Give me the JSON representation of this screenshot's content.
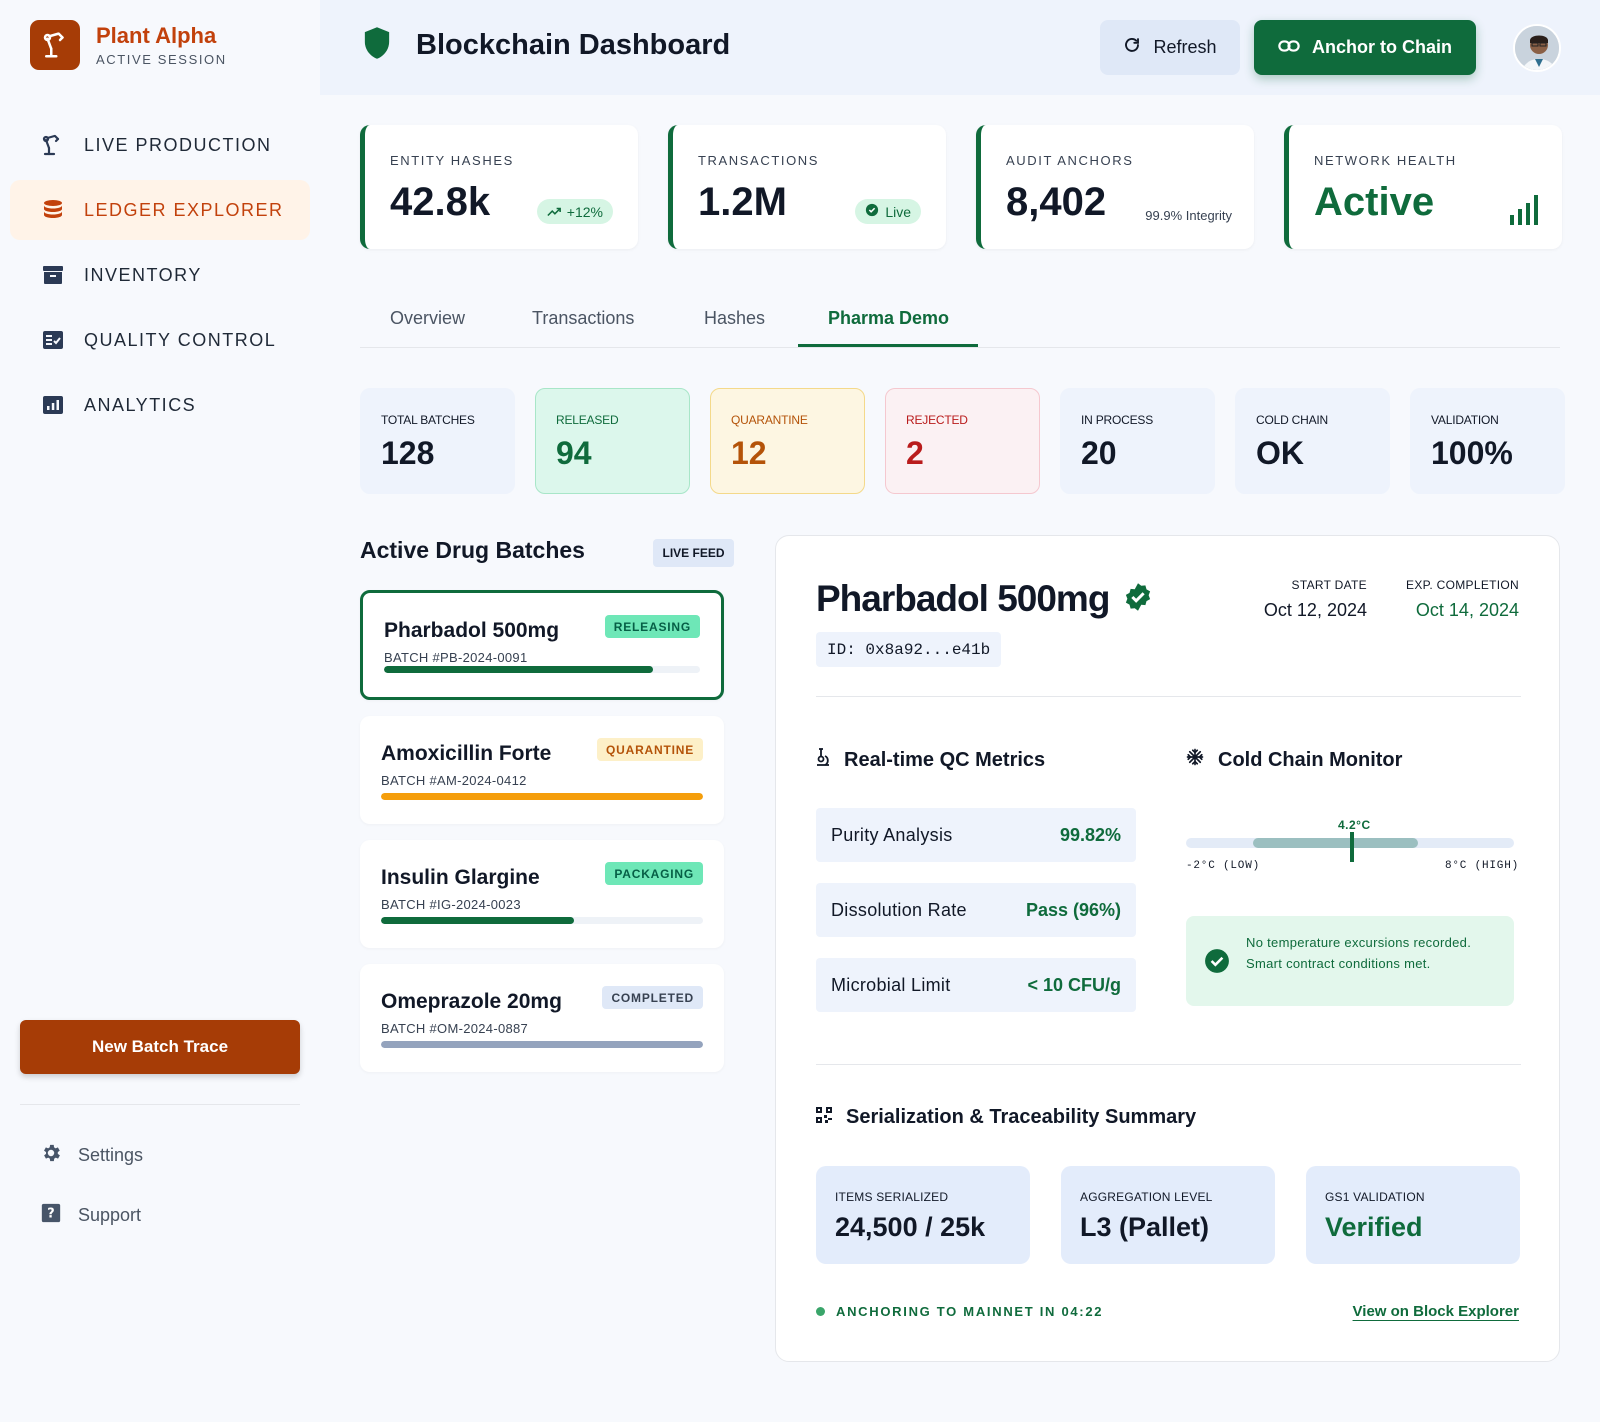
{
  "brand": {
    "name": "Plant Alpha",
    "subtitle": "ACTIVE SESSION",
    "color": "#c2410c",
    "logo_icon": "robot-arm-icon"
  },
  "sidebar": {
    "items": [
      {
        "label": "LIVE PRODUCTION",
        "icon": "robot-arm-icon",
        "active": false
      },
      {
        "label": "LEDGER EXPLORER",
        "icon": "database-icon",
        "active": true
      },
      {
        "label": "INVENTORY",
        "icon": "archive-icon",
        "active": false
      },
      {
        "label": "QUALITY CONTROL",
        "icon": "checklist-icon",
        "active": false
      },
      {
        "label": "ANALYTICS",
        "icon": "bar-chart-icon",
        "active": false
      }
    ],
    "new_batch_label": "New Batch Trace",
    "settings_label": "Settings",
    "support_label": "Support"
  },
  "header": {
    "title": "Blockchain Dashboard",
    "title_icon": "shield-icon",
    "refresh_label": "Refresh",
    "anchor_label": "Anchor to Chain"
  },
  "stats": [
    {
      "label": "ENTITY HASHES",
      "value": "42.8k",
      "badge": "+12%",
      "badge_icon": "trend-up-icon"
    },
    {
      "label": "TRANSACTIONS",
      "value": "1.2M",
      "badge": "Live",
      "badge_icon": "check-badge-icon"
    },
    {
      "label": "AUDIT ANCHORS",
      "value": "8,402",
      "note": "99.9% Integrity"
    },
    {
      "label": "NETWORK HEALTH",
      "value": "Active",
      "icon": "signal-bars-icon"
    }
  ],
  "tabs": [
    {
      "label": "Overview",
      "active": false
    },
    {
      "label": "Transactions",
      "active": false
    },
    {
      "label": "Hashes",
      "active": false
    },
    {
      "label": "Pharma Demo",
      "active": true
    }
  ],
  "summary": [
    {
      "label": "TOTAL BATCHES",
      "value": "128",
      "bg": "#eef3fc",
      "border": "#eef3fc",
      "color": "#111827"
    },
    {
      "label": "RELEASED",
      "value": "94",
      "bg": "#dcf7ec",
      "border": "#a8e6c8",
      "color": "#0f6b3c"
    },
    {
      "label": "QUARANTINE",
      "value": "12",
      "bg": "#fdf6e2",
      "border": "#f4d98a",
      "color": "#b45309"
    },
    {
      "label": "REJECTED",
      "value": "2",
      "bg": "#fbf1f3",
      "border": "#f5c8cf",
      "color": "#b91c1c"
    },
    {
      "label": "IN PROCESS",
      "value": "20",
      "bg": "#eef3fc",
      "border": "#eef3fc",
      "color": "#111827"
    },
    {
      "label": "COLD CHAIN",
      "value": "OK",
      "bg": "#eef3fc",
      "border": "#eef3fc",
      "color": "#111827"
    },
    {
      "label": "VALIDATION",
      "value": "100%",
      "bg": "#eef3fc",
      "border": "#eef3fc",
      "color": "#111827"
    }
  ],
  "batches": {
    "title": "Active Drug Batches",
    "feed_label": "LIVE FEED",
    "items": [
      {
        "name": "Pharbadol 500mg",
        "id": "BATCH #PB-2024-0091",
        "status": "RELEASING",
        "badge_bg": "#6ee7b7",
        "badge_color": "#065f46",
        "progress": 0.85,
        "bar_color": "#0f6b3c",
        "active": true
      },
      {
        "name": "Amoxicillin Forte",
        "id": "BATCH #AM-2024-0412",
        "status": "QUARANTINE",
        "badge_bg": "#fdf0c8",
        "badge_color": "#b45309",
        "progress": 1.0,
        "bar_color": "#f59e0b",
        "active": false
      },
      {
        "name": "Insulin Glargine",
        "id": "BATCH #IG-2024-0023",
        "status": "PACKAGING",
        "badge_bg": "#6ee7b7",
        "badge_color": "#065f46",
        "progress": 0.6,
        "bar_color": "#0f6b3c",
        "active": false
      },
      {
        "name": "Omeprazole 20mg",
        "id": "BATCH #OM-2024-0887",
        "status": "COMPLETED",
        "badge_bg": "#dfe8f7",
        "badge_color": "#374151",
        "progress": 1.0,
        "bar_color": "#94a3bd",
        "active": false
      }
    ]
  },
  "detail": {
    "name": "Pharbadol 500mg",
    "id": "ID: 0x8a92...e41b",
    "start_label": "START DATE",
    "start_value": "Oct 12, 2024",
    "exp_label": "EXP. COMPLETION",
    "exp_value": "Oct 14, 2024",
    "qc_title": "Real-time QC Metrics",
    "qc_rows": [
      {
        "label": "Purity Analysis",
        "value": "99.82%"
      },
      {
        "label": "Dissolution Rate",
        "value": "Pass (96%)"
      },
      {
        "label": "Microbial Limit",
        "value": "< 10 CFU/g"
      }
    ],
    "cold_title": "Cold Chain Monitor",
    "temp_value": "4.2°C",
    "temp_low": "-2°C (LOW)",
    "temp_high": "8°C (HIGH)",
    "cold_note": "No temperature excursions recorded. Smart contract conditions met.",
    "ser_title": "Serialization & Traceability Summary",
    "ser_tiles": [
      {
        "label": "ITEMS SERIALIZED",
        "value": "24,500 / 25k",
        "color": "#111827"
      },
      {
        "label": "AGGREGATION LEVEL",
        "value": "L3 (Pallet)",
        "color": "#111827"
      },
      {
        "label": "GS1 VALIDATION",
        "value": "Verified",
        "color": "#0f6b3c"
      }
    ],
    "anchor_status": "ANCHORING TO MAINNET IN 04:22",
    "explorer_link": "View on Block Explorer"
  },
  "colors": {
    "primary_green": "#0f6b3c",
    "brand_orange": "#a63c06"
  }
}
